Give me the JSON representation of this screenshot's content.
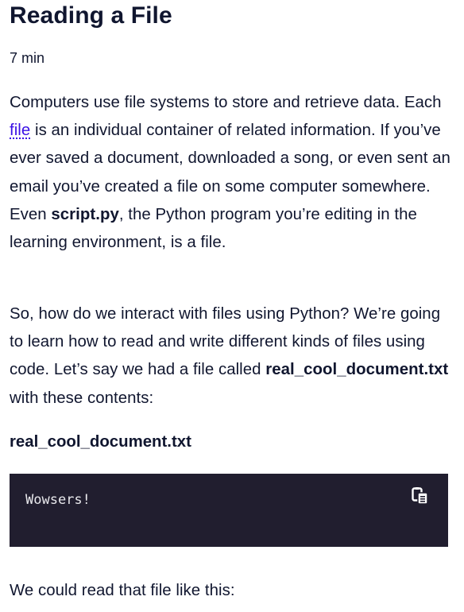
{
  "lesson": {
    "title": "Reading a File",
    "duration": "7 min"
  },
  "paragraph1": {
    "part1": "Computers use file systems to store and retrieve data. Each ",
    "link_text": "file",
    "part2": " is an individual container of related information. If you’ve ever saved a document, downloaded a song, or even sent an email you’ve created a file on some computer somewhere. Even ",
    "bold_text": "script.py",
    "part3": ", the Python program you’re editing in the learning environment, is a file."
  },
  "paragraph2": {
    "part1": "So, how do we interact with files using Python? We’re going to learn how to read and write different kinds of files using code. Let’s say we had a file called ",
    "bold_text": "real_cool_document.txt",
    "part2": " with these contents:"
  },
  "code_example": {
    "filename": "real_cool_document.txt",
    "content": "Wowsers!",
    "copy_icon": "copy-icon"
  },
  "paragraph3": {
    "text": "We could read that file like this:"
  },
  "colors": {
    "text": "#10162f",
    "link": "#3a10e5",
    "code_background": "#211e2f",
    "code_text": "#e8e8ec"
  }
}
